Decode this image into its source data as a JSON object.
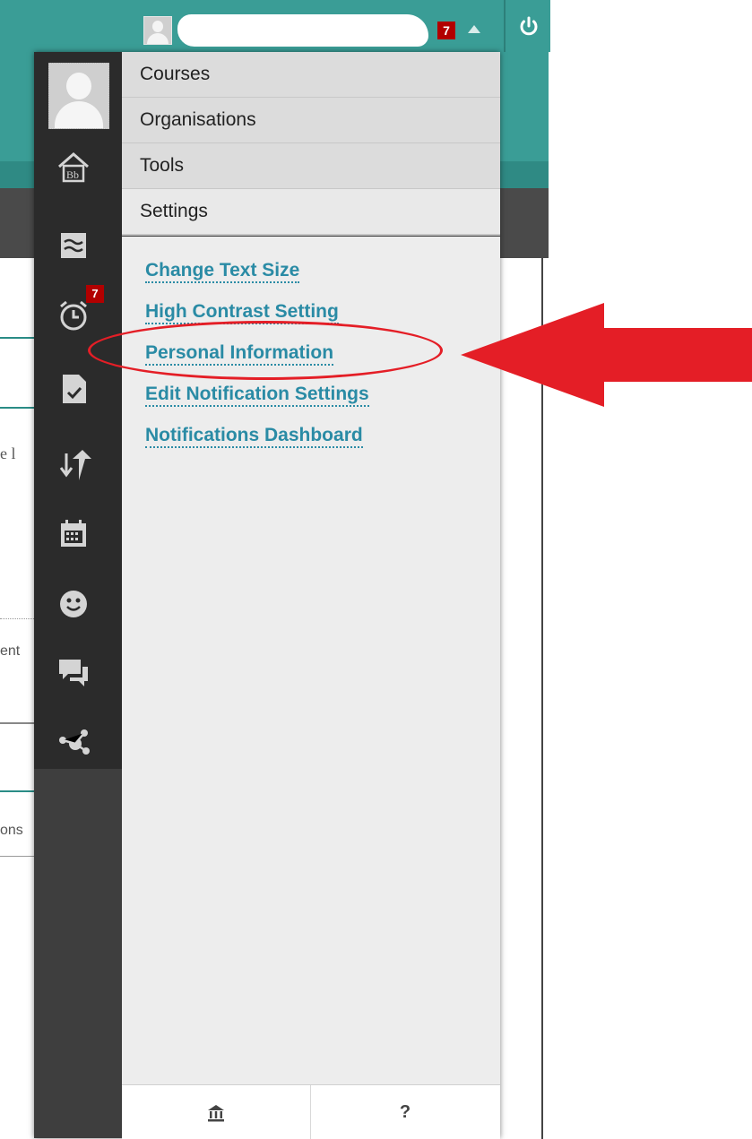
{
  "topbar": {
    "notification_count": "7",
    "user_name": "",
    "power_icon": "power-icon"
  },
  "rail": {
    "icons": [
      "home-icon",
      "stream-icon",
      "alarm-clock-icon",
      "checklist-icon",
      "updown-arrows-icon",
      "calendar-icon",
      "smiley-icon",
      "chat-icon",
      "network-icon"
    ],
    "badge_count": "7"
  },
  "menu": {
    "categories": [
      "Courses",
      "Organisations",
      "Tools",
      "Settings"
    ],
    "active_category": "Settings",
    "settings_links": [
      "Change Text Size",
      "High Contrast Setting",
      "Personal Information",
      "Edit Notification Settings",
      "Notifications Dashboard"
    ],
    "highlighted_link": "Personal Information"
  },
  "footer": {
    "home_icon": "institution-icon",
    "help_label": "?"
  },
  "background_fragments": [
    "e l",
    "ent",
    "ons"
  ],
  "colors": {
    "header_teal": "#3a9d96",
    "link_blue": "#2a8ba5",
    "badge_red": "#b20000",
    "annotation_red": "#e41e26"
  }
}
